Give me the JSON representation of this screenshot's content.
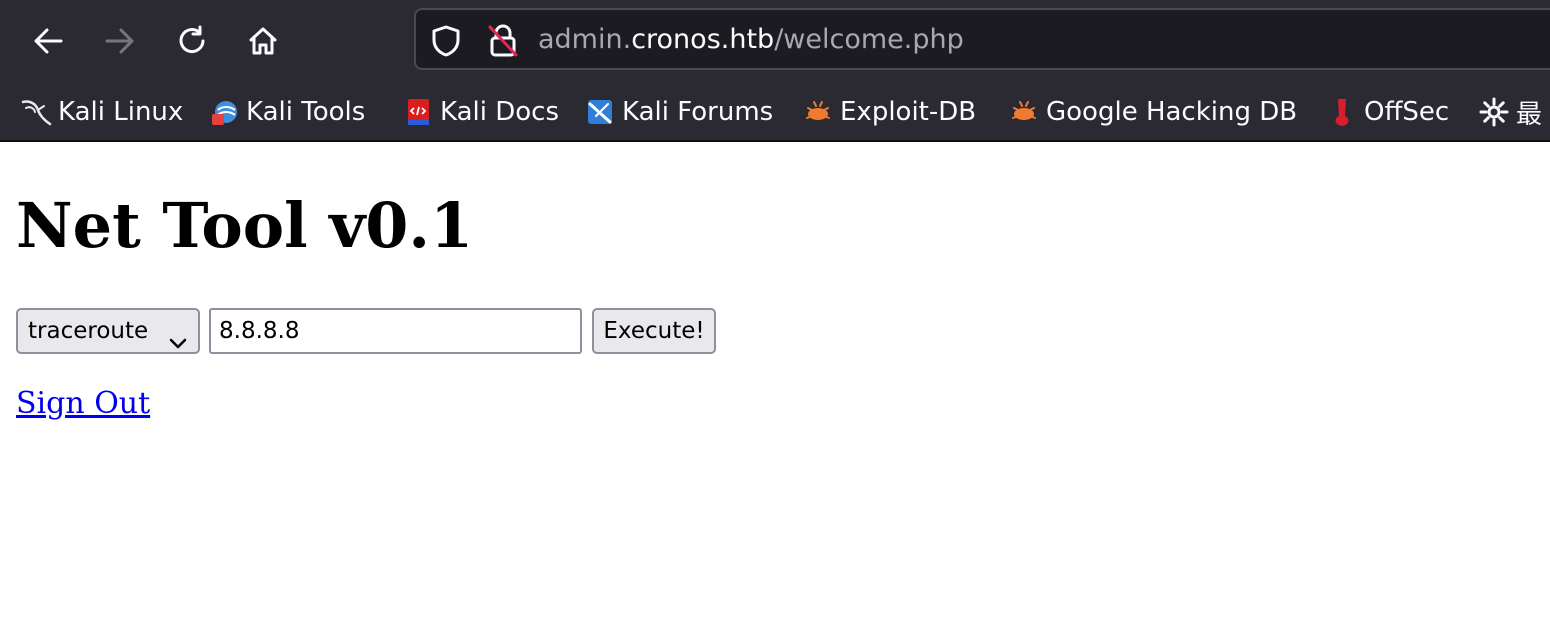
{
  "browser": {
    "url": {
      "subdomain": "admin.",
      "host": "cronos.htb",
      "path": "/welcome.php"
    },
    "nav_icons": [
      "back-arrow-icon",
      "forward-arrow-icon",
      "reload-icon",
      "home-icon"
    ],
    "bookmarks": [
      {
        "label": "Kali Linux",
        "icon": "kali-dragon-icon"
      },
      {
        "label": "Kali Tools",
        "icon": "kali-tools-icon"
      },
      {
        "label": "Kali Docs",
        "icon": "kali-docs-icon"
      },
      {
        "label": "Kali Forums",
        "icon": "kali-forums-icon"
      },
      {
        "label": "Exploit-DB",
        "icon": "exploit-db-icon"
      },
      {
        "label": "Google Hacking DB",
        "icon": "ghdb-icon"
      },
      {
        "label": "OffSec",
        "icon": "offsec-icon"
      },
      {
        "label": "最",
        "icon": "gear-icon"
      }
    ]
  },
  "page": {
    "title": "Net Tool v0.1",
    "command_select": {
      "selected": "traceroute"
    },
    "host_input": {
      "value": "8.8.8.8"
    },
    "execute_label": "Execute!",
    "signout_label": "Sign Out"
  },
  "colors": {
    "toolbar_bg": "#2b2a33",
    "urlbar_bg": "#1c1b22",
    "link": "#0000ee"
  }
}
